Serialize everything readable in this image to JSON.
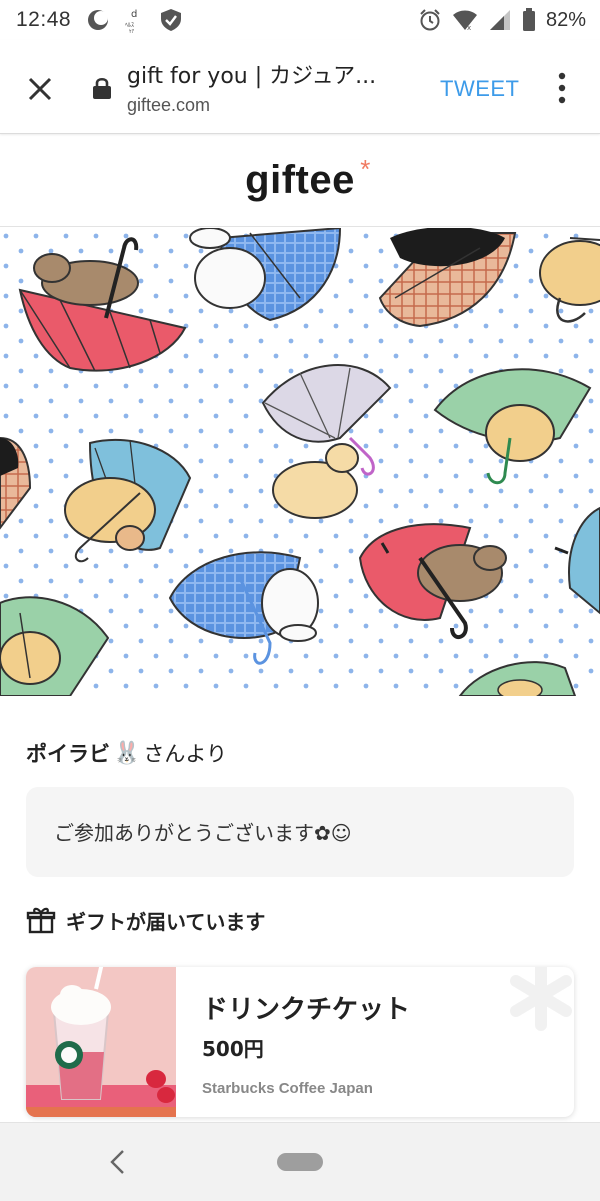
{
  "status": {
    "time": "12:48",
    "battery_pct": "82%",
    "icons": [
      "moon-icon",
      "d-health-icon",
      "shield-icon",
      "alarm-icon",
      "wifi-icon",
      "signal-icon",
      "battery-icon"
    ]
  },
  "browser": {
    "title": "gift for you | カジュア...",
    "domain": "giftee.com",
    "tweet_label": "TWEET"
  },
  "site": {
    "logo": "giftee",
    "logo_mark": "*"
  },
  "gift": {
    "sender_name": "ポイラビ",
    "sender_emoji": "🐰",
    "sender_suffix": "さんより",
    "message": "ご参加ありがとうございます✿☺",
    "section_label": "ギフトが届いています"
  },
  "product": {
    "name": "ドリンクチケット",
    "price": "500円",
    "brand": "Starbucks Coffee Japan"
  },
  "colors": {
    "accent": "#3d9be9",
    "logo_star": "#f07b62"
  }
}
